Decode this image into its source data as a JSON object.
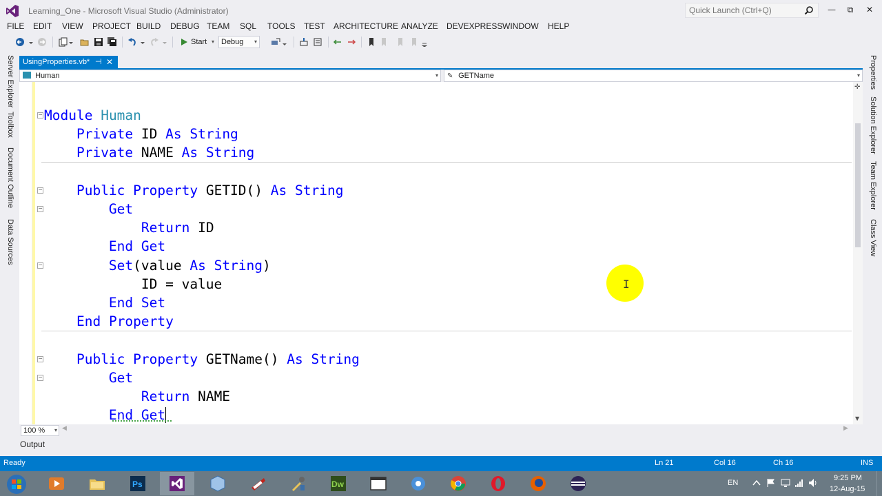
{
  "window": {
    "title": "Learning_One - Microsoft Visual Studio (Administrator)",
    "quick_launch_placeholder": "Quick Launch (Ctrl+Q)",
    "minimize": "—",
    "restore": "⧉",
    "close": "✕"
  },
  "menu": [
    "FILE",
    "EDIT",
    "VIEW",
    "PROJECT",
    "BUILD",
    "DEBUG",
    "TEAM",
    "SQL",
    "TOOLS",
    "TEST",
    "ARCHITECTURE",
    "ANALYZE",
    "DEVEXPRESS",
    "WINDOW",
    "HELP"
  ],
  "toolbar": {
    "start_label": "Start",
    "configuration": "Debug"
  },
  "left_tabs": [
    "Server Explorer",
    "Toolbox",
    "Document Outline",
    "Data Sources"
  ],
  "right_tabs": [
    "Properties",
    "Solution Explorer",
    "Team Explorer",
    "Class View"
  ],
  "document_tab": {
    "label": "UsingProperties.vb*",
    "pin": "⊣",
    "close": "✕"
  },
  "nav": {
    "type_label": "Human",
    "member_label": "GETName"
  },
  "code_lines": [
    "Module Human",
    "    Private ID As String",
    "    Private NAME As String",
    "",
    "    Public Property GETID() As String",
    "        Get",
    "            Return ID",
    "        End Get",
    "        Set(value As String)",
    "            ID = value",
    "        End Set",
    "    End Property",
    "",
    "    Public Property GETName() As String",
    "        Get",
    "            Return NAME",
    "        End Get"
  ],
  "zoom": "100 %",
  "output_tab": "Output",
  "status": {
    "state": "Ready",
    "line": "Ln 21",
    "col": "Col 16",
    "ch": "Ch 16",
    "mode": "INS"
  },
  "taskbar": {
    "apps": [
      "start-orb-icon",
      "media-player-icon",
      "file-explorer-icon",
      "photoshop-icon",
      "visual-studio-icon",
      "virtualbox-icon",
      "filezilla-icon",
      "tools-icon",
      "dreamweaver-icon",
      "window-icon",
      "network-icon",
      "chrome-icon",
      "opera-icon",
      "firefox-icon",
      "eclipse-icon"
    ],
    "language": "EN",
    "time": "9:25 PM",
    "date": "12-Aug-15"
  },
  "colors": {
    "accent": "#007acc",
    "keyword": "#0000ff",
    "type": "#2b91af",
    "change_bar": "#fff8a8",
    "highlight": "#ffff00"
  }
}
